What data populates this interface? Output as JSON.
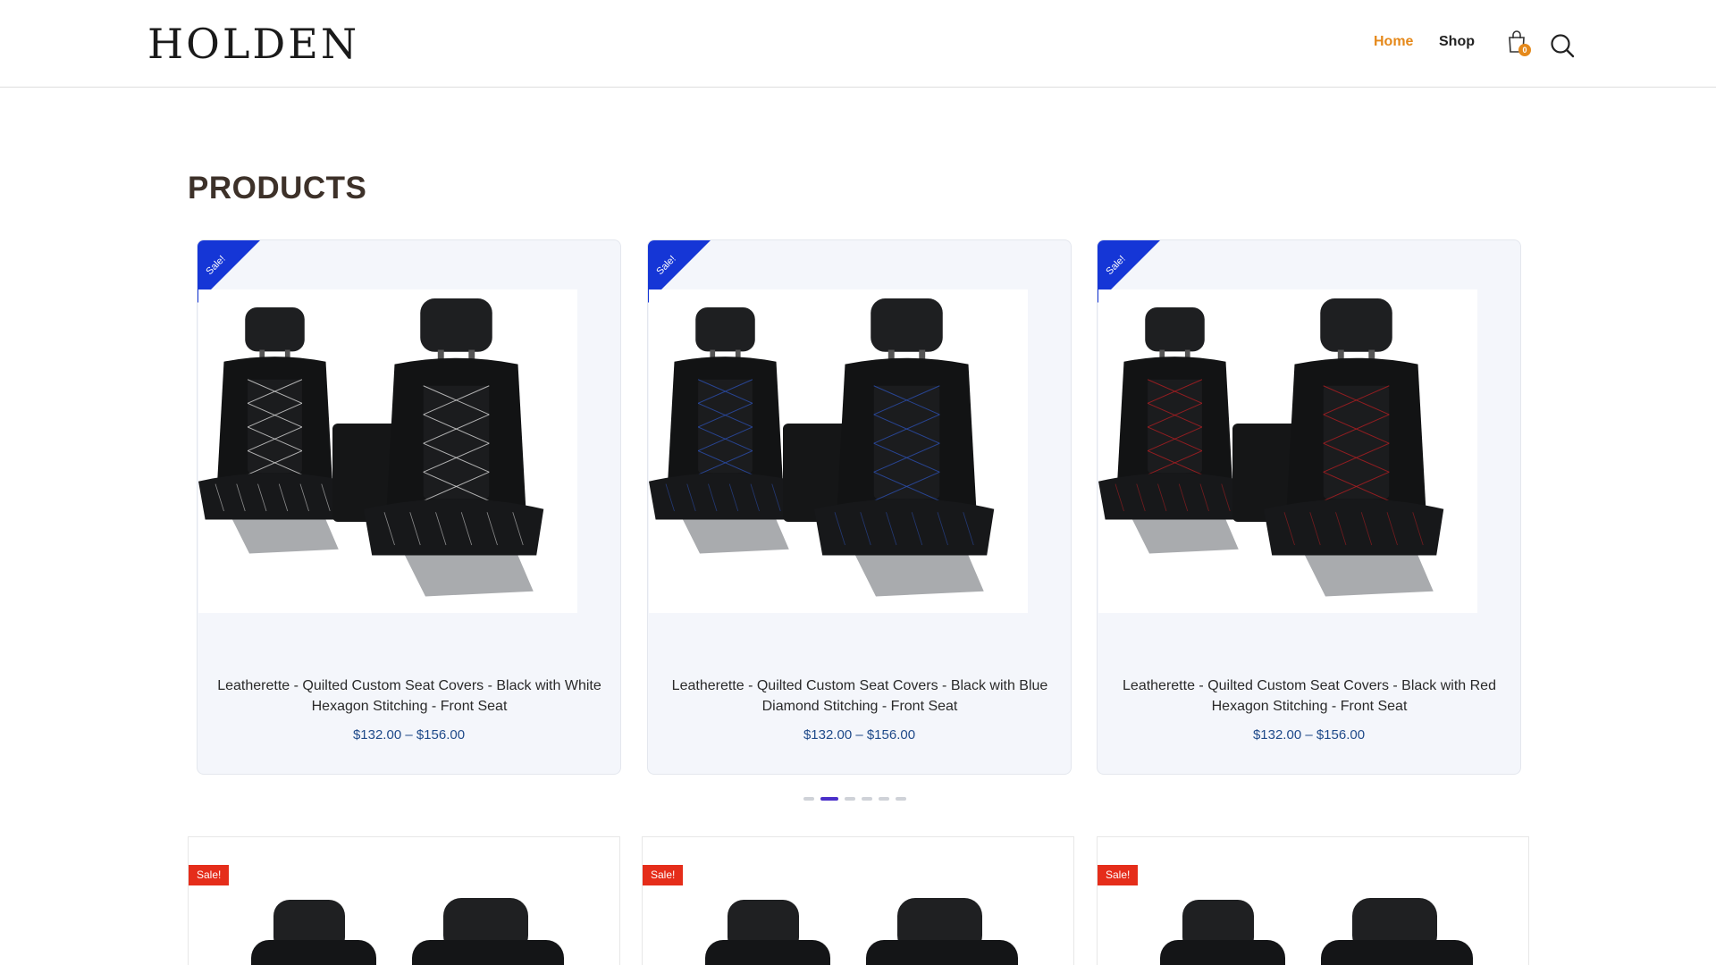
{
  "header": {
    "logo": "HOLDEN",
    "nav": [
      {
        "label": "Home",
        "active": true
      },
      {
        "label": "Shop",
        "active": false
      }
    ],
    "cart_count": "0",
    "accent_color": "#e5891b"
  },
  "section_title": "PRODUCTS",
  "carousel": {
    "products": [
      {
        "badge": "Sale!",
        "title": "Leatherette - Quilted Custom Seat Covers - Black with White Hexagon Stitching - Front Seat",
        "price": "$132.00 – $156.00",
        "stitch_color": "#d8d8d8"
      },
      {
        "badge": "Sale!",
        "title": "Leatherette - Quilted Custom Seat Covers - Black with Blue Diamond Stitching - Front Seat",
        "price": "$132.00 – $156.00",
        "stitch_color": "#2c4fb0"
      },
      {
        "badge": "Sale!",
        "title": "Leatherette - Quilted Custom Seat Covers - Black with Red Hexagon Stitching - Front Seat",
        "price": "$132.00 – $156.00",
        "stitch_color": "#b01e22"
      }
    ],
    "dots_count": 6,
    "active_dot": 1
  },
  "grid": {
    "items": [
      {
        "badge": "Sale!"
      },
      {
        "badge": "Sale!"
      },
      {
        "badge": "Sale!"
      }
    ]
  },
  "colors": {
    "ribbon": "#1536d6",
    "sale_badge": "#e52d1a",
    "price": "#1f4a8a",
    "active_dot": "#4a2fc9"
  }
}
